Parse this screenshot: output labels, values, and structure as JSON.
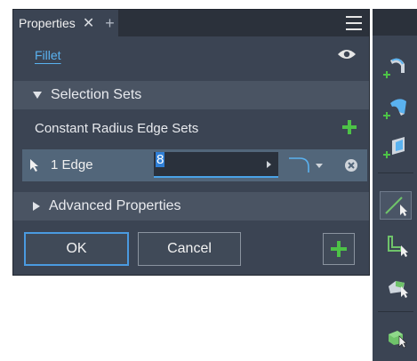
{
  "panel": {
    "tab_title": "Properties",
    "tab_close": "✕",
    "tab_add": "+",
    "mode_label": "Fillet",
    "selection_sets_label": "Selection Sets",
    "constant_radius_label": "Constant Radius Edge Sets",
    "edge_set": {
      "label": "1 Edge",
      "radius_value": "8"
    },
    "advanced_properties_label": "Advanced Properties",
    "ok_label": "OK",
    "cancel_label": "Cancel"
  },
  "icons": {
    "menu": "hamburger-icon",
    "visibility": "eye-icon",
    "add": "plus-icon",
    "select": "cursor-icon",
    "profile": "fillet-profile-icon",
    "clear": "clear-icon",
    "apply": "apply-plus-icon"
  },
  "colors": {
    "panel_bg": "#3b4453",
    "header_bg": "#2b313b",
    "section_bg": "#4a5463",
    "selected_row_bg": "#52667a",
    "accent_blue": "#4aa3e8",
    "add_green": "#4dc247",
    "link_blue": "#5ab2f0"
  },
  "toolbar": {
    "buttons": [
      "fillet-edge",
      "fillet-face",
      "fillet-full-round",
      "select-edge",
      "select-loop",
      "select-feature",
      "select-solid"
    ]
  }
}
